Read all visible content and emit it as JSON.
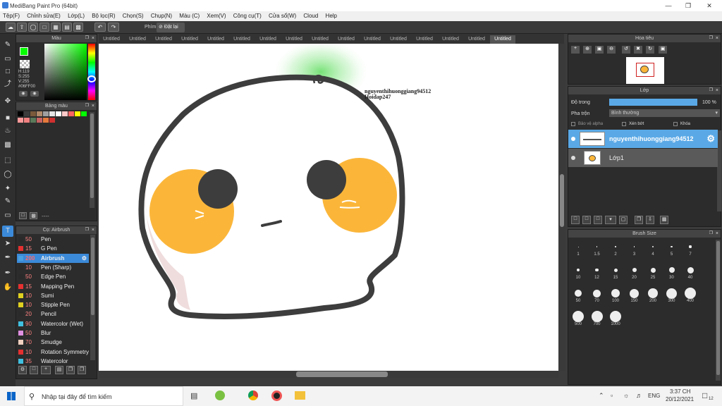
{
  "window": {
    "title": "MediBang Paint Pro (64bit)"
  },
  "menu": [
    "Tệp(F)",
    "Chỉnh sửa(E)",
    "Lớp(L)",
    "Bộ lọc(R)",
    "Chọn(S)",
    "Chụp(N)",
    "Màu (C)",
    "Xem(V)",
    "Công cụ(T)",
    "Cửa sổ(W)",
    "Cloud",
    "Help"
  ],
  "toolbar": {
    "label": "Phím",
    "reset_label": "Đặt lại"
  },
  "color_panel": {
    "title": "Màu",
    "h": "H:119",
    "s": "S:255",
    "v": "V:255",
    "hex": "#06FF00",
    "fg": "#06ff00",
    "bg": "#000000"
  },
  "palette_panel": {
    "title": "Bảng màu",
    "colors": [
      "#000000",
      "#3c3c3c",
      "#7a5a3a",
      "#b08a6a",
      "#a0a0a0",
      "#e6e6e6",
      "#ffffff",
      "#ffc8c8",
      "#ff6464",
      "#ffff00",
      "#00ff00",
      "#ff9a9a",
      "#f08080",
      "#5a7a5a",
      "#c86464",
      "#e67a3c",
      "#d03030"
    ],
    "dots": "----"
  },
  "brush_panel": {
    "title": "Cọ: Airbrush",
    "brushes": [
      {
        "size": "50",
        "name": "Pen",
        "color": "#2a2a2a"
      },
      {
        "size": "15",
        "name": "G Pen",
        "color": "#e53030"
      },
      {
        "size": "200",
        "name": "Airbrush",
        "color": "#4aa0e0"
      },
      {
        "size": "10",
        "name": "Pen (Sharp)",
        "color": "#2a2a2a"
      },
      {
        "size": "50",
        "name": "Edge Pen",
        "color": "#2a2a2a"
      },
      {
        "size": "15",
        "name": "Mapping Pen",
        "color": "#e53030"
      },
      {
        "size": "10",
        "name": "Sumi",
        "color": "#e0d020"
      },
      {
        "size": "10",
        "name": "Stipple Pen",
        "color": "#e0d020"
      },
      {
        "size": "20",
        "name": "Pencil",
        "color": "#2a2a2a"
      },
      {
        "size": "90",
        "name": "Watercolor (Wet)",
        "color": "#40c0e0"
      },
      {
        "size": "50",
        "name": "Blur",
        "color": "#e090e0"
      },
      {
        "size": "70",
        "name": "Smudge",
        "color": "#f0d0c0"
      },
      {
        "size": "10",
        "name": "Rotation Symmetry",
        "color": "#e53030"
      },
      {
        "size": "35",
        "name": "Watercolor",
        "color": "#40c0e0"
      }
    ]
  },
  "tabs": [
    "Untitled",
    "Untitled",
    "Untitled",
    "Untitled",
    "Untitled",
    "Untitled",
    "Untitled",
    "Untitled",
    "Untitled",
    "Untitled",
    "Untitled",
    "Untitled",
    "Untitled",
    "Untitled",
    "Untitled",
    "Untitled"
  ],
  "canvas": {
    "text_line1": "nguyenthihuonggiang94512",
    "text_line2": "Hoidap247"
  },
  "navigator": {
    "title": "Hoa tiêu"
  },
  "layer_panel": {
    "title": "Lớp",
    "opacity_label": "Độ trong",
    "opacity_value": "100 %",
    "opacity": 1.0,
    "blend_label": "Pha trộn",
    "blend_value": "Bình thường",
    "protect_alpha": "Bảo vệ alpha",
    "clipping": "Xén bớt",
    "lock": "Khóa",
    "layers": [
      {
        "name": "nguyenthihuonggiang94512",
        "selected": true
      },
      {
        "name": "Lớp1",
        "selected": false
      }
    ]
  },
  "brush_size_panel": {
    "title": "Brush Size",
    "sizes": [
      "1",
      "1.5",
      "2",
      "3",
      "4",
      "5",
      "7",
      "10",
      "12",
      "15",
      "20",
      "25",
      "30",
      "40",
      "50",
      "70",
      "100",
      "150",
      "200",
      "300",
      "400",
      "500",
      "700",
      "1000"
    ]
  },
  "taskbar": {
    "search_placeholder": "Nhập tại đây để tìm kiếm",
    "lang": "ENG",
    "time": "3:37 CH",
    "date": "20/12/2021",
    "notif_count": "12"
  }
}
